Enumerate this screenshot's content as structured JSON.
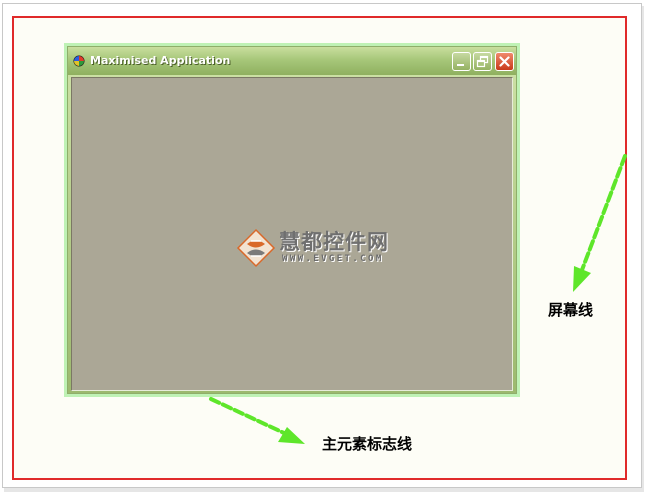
{
  "window": {
    "title": "Maximised Application",
    "buttons": {
      "minimize": "minimize-icon",
      "restore": "restore-icon",
      "close": "close-icon"
    }
  },
  "watermark": {
    "chinese": "慧都控件网",
    "url": "WWW.EVGET.COM"
  },
  "annotations": {
    "screen_line": "屏幕线",
    "main_element_line": "主元素标志线"
  },
  "colors": {
    "screen_border": "#e02a2a",
    "main_line": "#bff2b5",
    "arrow": "#5ee62a",
    "client_bg": "#aba796",
    "close_button": "#d8482a"
  }
}
